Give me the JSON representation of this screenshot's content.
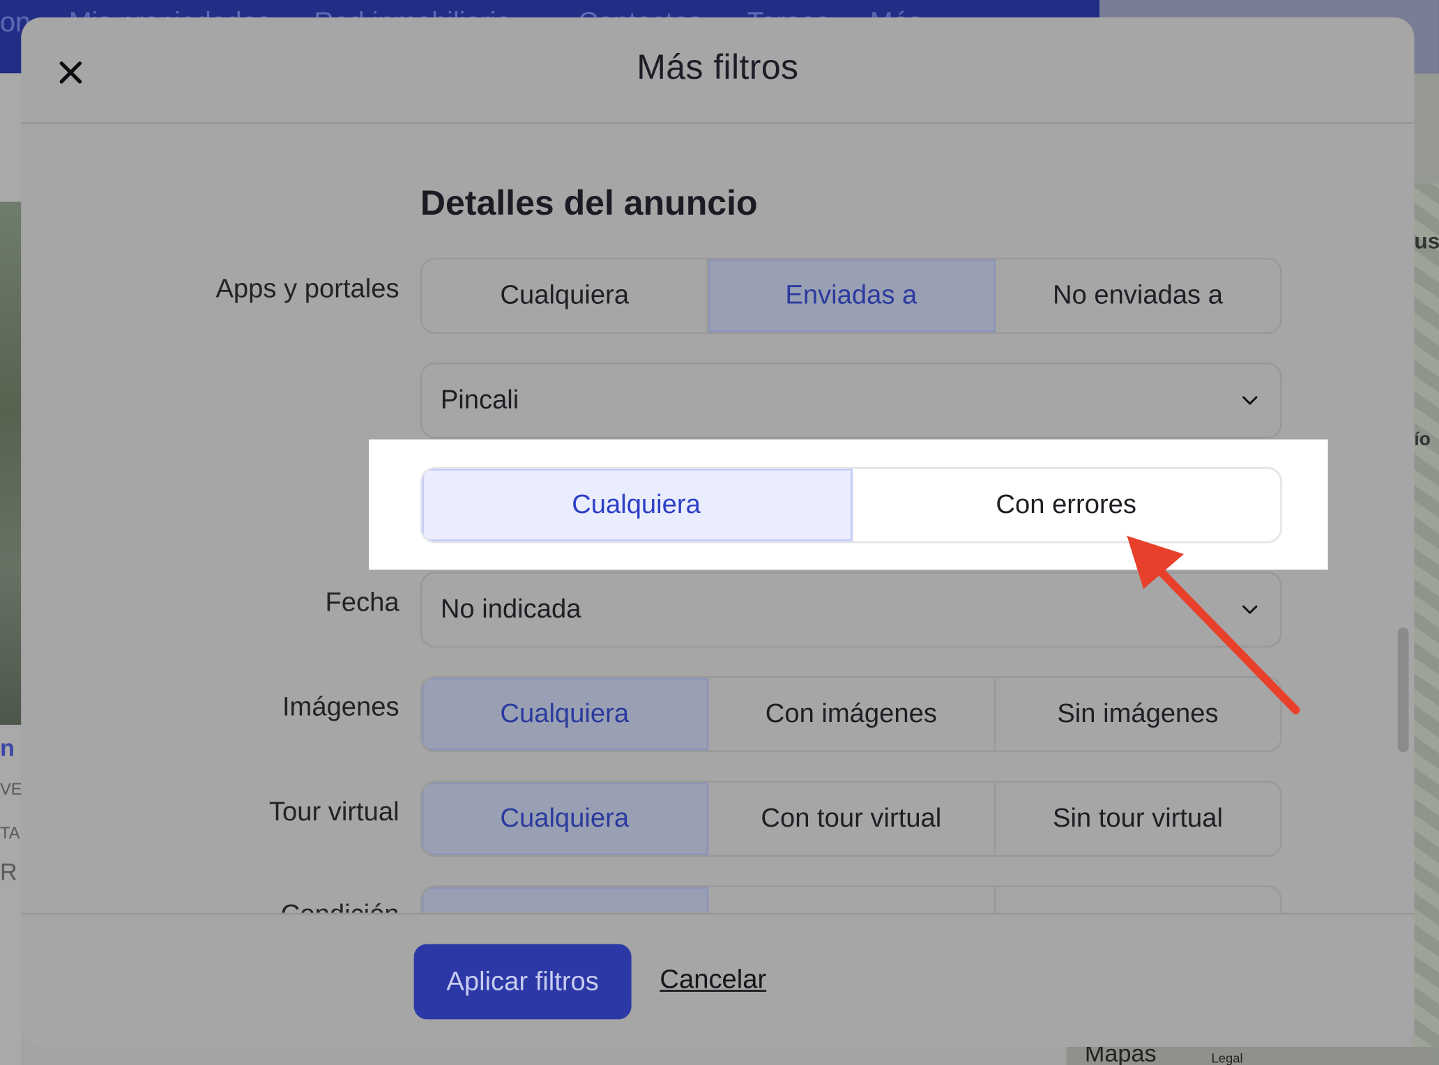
{
  "background": {
    "nav_items": [
      "on",
      "Mis propiedades",
      "Red inmobiliaria",
      "Contactos",
      "Tareas",
      "Más"
    ],
    "left_letters": [
      "n",
      "VE",
      "TA",
      "R"
    ],
    "right_texts": [
      "us",
      "ío"
    ],
    "maps_label": "Mapas",
    "legal_label": "Legal"
  },
  "modal": {
    "title": "Más filtros",
    "section_title": "Detalles del anuncio",
    "apps": {
      "label": "Apps y portales",
      "options": [
        "Cualquiera",
        "Enviadas a",
        "No enviadas a"
      ],
      "selected": "Enviadas a"
    },
    "portal_select": {
      "value": "Pincali"
    },
    "errors": {
      "options": [
        "Cualquiera",
        "Con errores"
      ],
      "selected": "Cualquiera"
    },
    "fecha": {
      "label": "Fecha",
      "value": "No indicada"
    },
    "imagenes": {
      "label": "Imágenes",
      "options": [
        "Cualquiera",
        "Con imágenes",
        "Sin imágenes"
      ],
      "selected": "Cualquiera"
    },
    "tour": {
      "label": "Tour virtual",
      "options": [
        "Cualquiera",
        "Con tour virtual",
        "Sin tour virtual"
      ],
      "selected": "Cualquiera"
    },
    "condicion": {
      "label": "Condición"
    },
    "apply_label": "Aplicar filtros",
    "cancel_label": "Cancelar"
  },
  "colors": {
    "overlay": "#a6a6a6",
    "primary": "#2b38a5",
    "selected_text": "#2d3fc7",
    "annotation_arrow": "#e8402a"
  }
}
